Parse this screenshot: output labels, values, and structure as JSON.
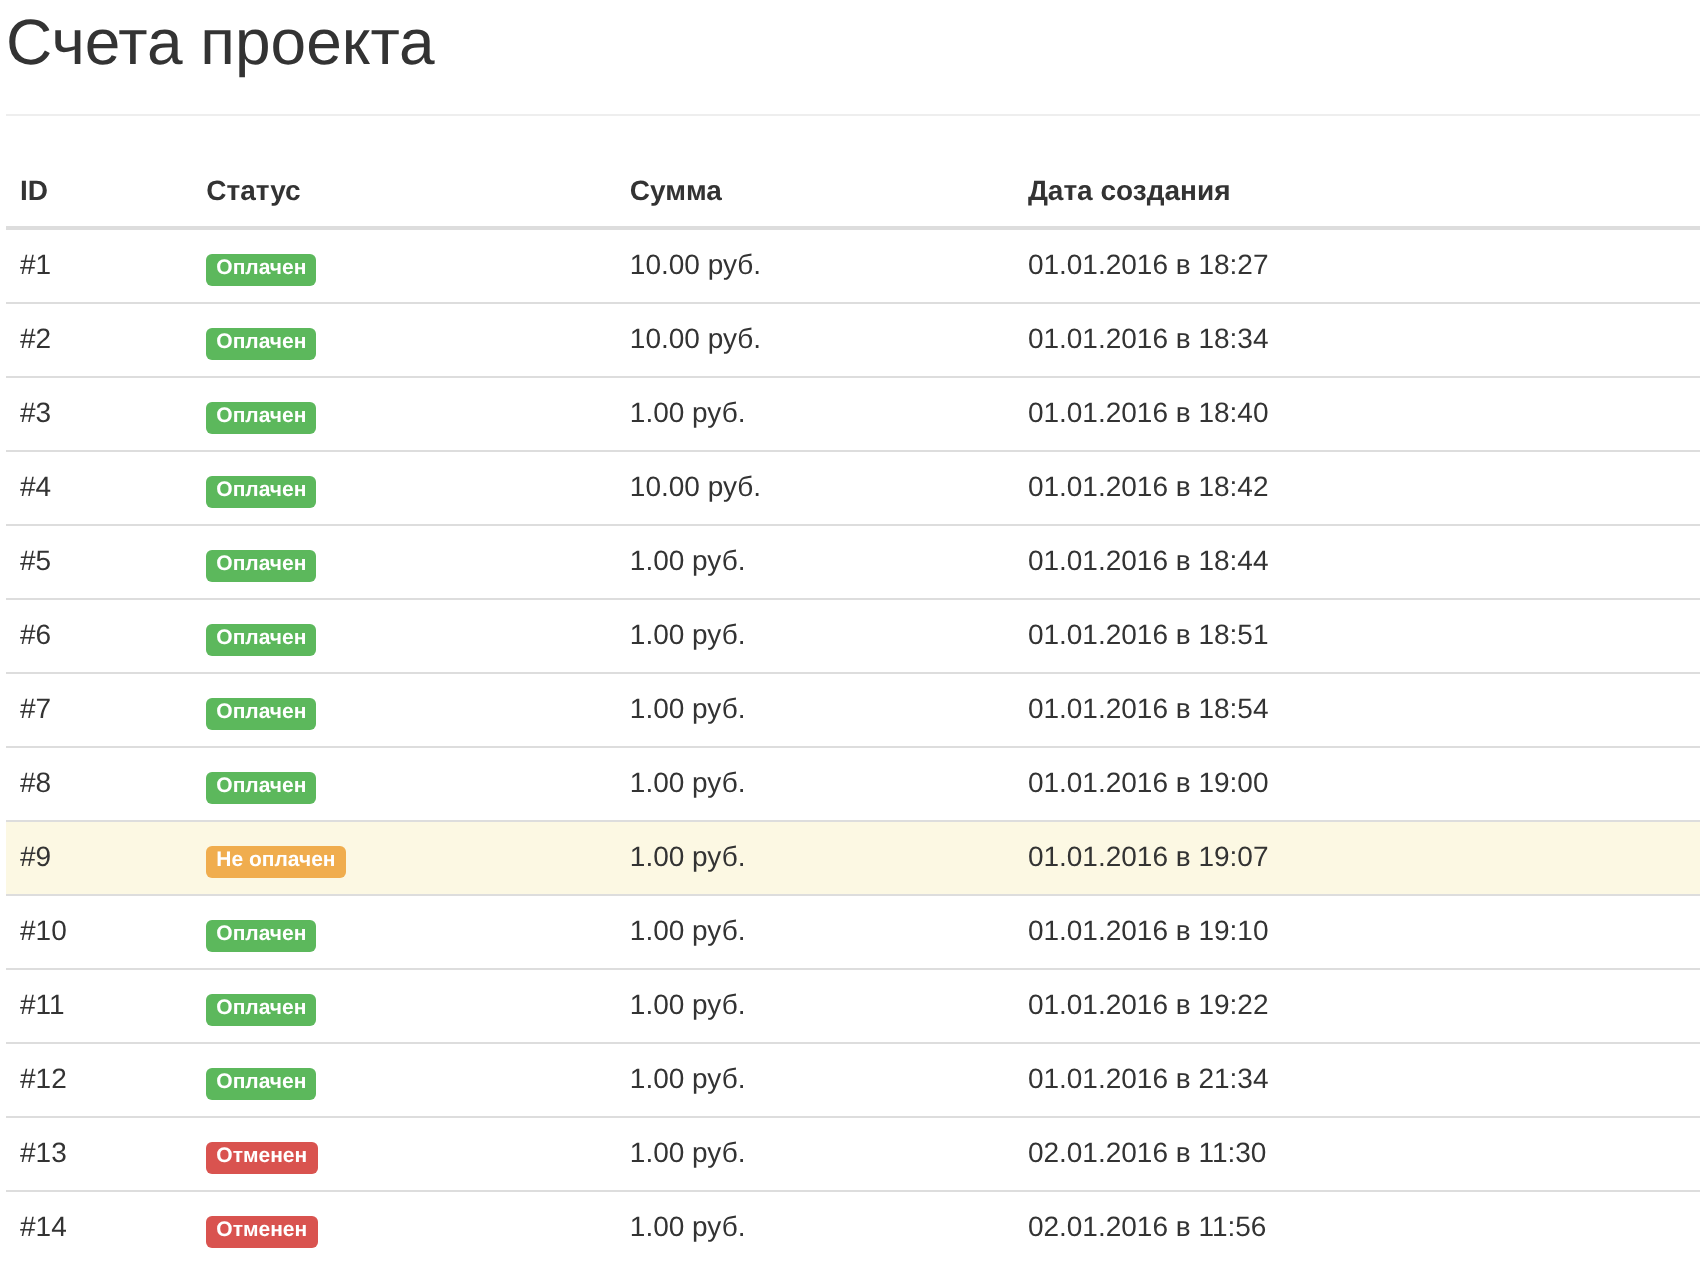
{
  "title": "Счета проекта",
  "table": {
    "columns": [
      "ID",
      "Статус",
      "Сумма",
      "Дата создания"
    ],
    "rows": [
      {
        "id": "#1",
        "status": {
          "label": "Оплачен",
          "kind": "paid"
        },
        "amount": "10.00 руб.",
        "date": "01.01.2016 в 18:27",
        "highlighted": false
      },
      {
        "id": "#2",
        "status": {
          "label": "Оплачен",
          "kind": "paid"
        },
        "amount": "10.00 руб.",
        "date": "01.01.2016 в 18:34",
        "highlighted": false
      },
      {
        "id": "#3",
        "status": {
          "label": "Оплачен",
          "kind": "paid"
        },
        "amount": "1.00 руб.",
        "date": "01.01.2016 в 18:40",
        "highlighted": false
      },
      {
        "id": "#4",
        "status": {
          "label": "Оплачен",
          "kind": "paid"
        },
        "amount": "10.00 руб.",
        "date": "01.01.2016 в 18:42",
        "highlighted": false
      },
      {
        "id": "#5",
        "status": {
          "label": "Оплачен",
          "kind": "paid"
        },
        "amount": "1.00 руб.",
        "date": "01.01.2016 в 18:44",
        "highlighted": false
      },
      {
        "id": "#6",
        "status": {
          "label": "Оплачен",
          "kind": "paid"
        },
        "amount": "1.00 руб.",
        "date": "01.01.2016 в 18:51",
        "highlighted": false
      },
      {
        "id": "#7",
        "status": {
          "label": "Оплачен",
          "kind": "paid"
        },
        "amount": "1.00 руб.",
        "date": "01.01.2016 в 18:54",
        "highlighted": false
      },
      {
        "id": "#8",
        "status": {
          "label": "Оплачен",
          "kind": "paid"
        },
        "amount": "1.00 руб.",
        "date": "01.01.2016 в 19:00",
        "highlighted": false
      },
      {
        "id": "#9",
        "status": {
          "label": "Не оплачен",
          "kind": "unpaid"
        },
        "amount": "1.00 руб.",
        "date": "01.01.2016 в 19:07",
        "highlighted": true
      },
      {
        "id": "#10",
        "status": {
          "label": "Оплачен",
          "kind": "paid"
        },
        "amount": "1.00 руб.",
        "date": "01.01.2016 в 19:10",
        "highlighted": false
      },
      {
        "id": "#11",
        "status": {
          "label": "Оплачен",
          "kind": "paid"
        },
        "amount": "1.00 руб.",
        "date": "01.01.2016 в 19:22",
        "highlighted": false
      },
      {
        "id": "#12",
        "status": {
          "label": "Оплачен",
          "kind": "paid"
        },
        "amount": "1.00 руб.",
        "date": "01.01.2016 в 21:34",
        "highlighted": false
      },
      {
        "id": "#13",
        "status": {
          "label": "Отменен",
          "kind": "cancelled"
        },
        "amount": "1.00 руб.",
        "date": "02.01.2016 в 11:30",
        "highlighted": false
      },
      {
        "id": "#14",
        "status": {
          "label": "Отменен",
          "kind": "cancelled"
        },
        "amount": "1.00 руб.",
        "date": "02.01.2016 в 11:56",
        "highlighted": false
      }
    ]
  }
}
